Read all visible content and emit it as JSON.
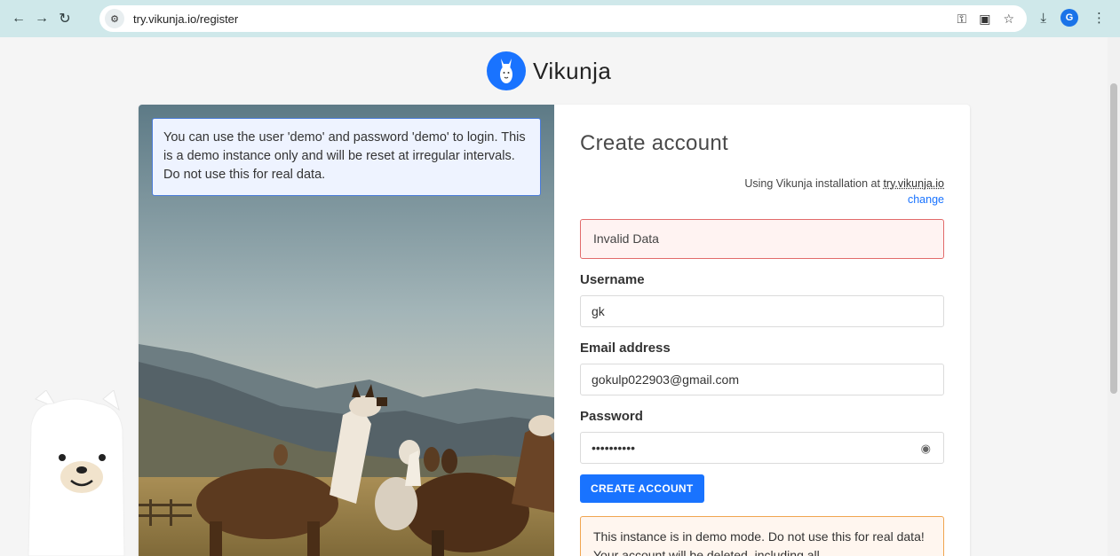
{
  "browser": {
    "url": "try.vikunja.io/register",
    "profile_initial": "G"
  },
  "app": {
    "name": "Vikunja"
  },
  "notice": {
    "text": "You can use the user 'demo' and password 'demo' to login. This is a demo instance only and will be reset at irregular intervals. Do not use this for real data."
  },
  "form": {
    "title": "Create account",
    "install_prefix": "Using Vikunja installation at ",
    "install_host": "try.vikunja.io",
    "change_label": "change",
    "error_message": "Invalid Data",
    "username_label": "Username",
    "username_value": "gk",
    "email_label": "Email address",
    "email_value": "gokulp022903@gmail.com",
    "password_label": "Password",
    "password_value": "••••••••••",
    "submit_label": "CREATE ACCOUNT",
    "demo_warning": "This instance is in demo mode. Do not use this for real data! Your account will be deleted, including all"
  },
  "colors": {
    "primary": "#1973ff",
    "error_border": "#e26b6b",
    "warning_border": "#f0a550",
    "chrome": "#cfe8ea"
  }
}
